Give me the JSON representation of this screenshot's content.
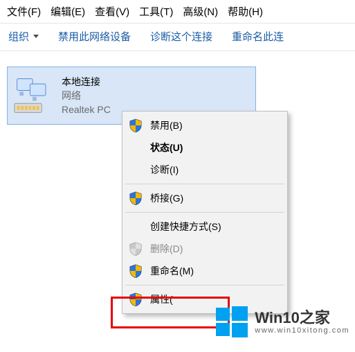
{
  "menubar": {
    "file": "文件(F)",
    "edit": "编辑(E)",
    "view": "查看(V)",
    "tools": "工具(T)",
    "advanced": "高级(N)",
    "help": "帮助(H)"
  },
  "toolbar": {
    "organize": "组织",
    "disable_device": "禁用此网络设备",
    "diagnose": "诊断这个连接",
    "rename": "重命名此连"
  },
  "connection": {
    "title": "本地连接",
    "network": "网络",
    "adapter": "Realtek PC"
  },
  "context_menu": {
    "disable": "禁用(B)",
    "status": "状态(U)",
    "diagnose": "诊断(I)",
    "bridge": "桥接(G)",
    "shortcut": "创建快捷方式(S)",
    "delete": "删除(D)",
    "rename": "重命名(M)",
    "properties": "属性("
  },
  "watermark": {
    "title": "Win10之家",
    "url": "www.win10xitong.com"
  },
  "colors": {
    "shield_blue": "#2e75d4",
    "shield_yellow": "#f5b800",
    "win_blue": "#00a1f1",
    "selection": "#d8e6f7",
    "highlight": "#e60000"
  }
}
